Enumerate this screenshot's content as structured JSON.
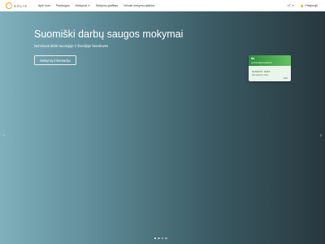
{
  "nav": {
    "logo_text": "SOLIS",
    "links": [
      "Apie mus",
      "Paslaugos",
      "Mokymai",
      "Mokymų grafikas",
      "Virtuali mokymų aplinka"
    ],
    "language": "LT",
    "login": "Prisijungti"
  },
  "hero": {
    "title": "Suomiški darbų saugos mokymai",
    "subtitle": "Nominuoti dirbti Suomijoje ir Švedijoje bendrovės",
    "button": "Mokymų informacija"
  },
  "card": {
    "brand": "tta",
    "subtitle": "työturvallisuuskortti",
    "number": "0160176 0297",
    "name": "Esimerkkinen Tiina",
    "year": "2023"
  },
  "carousel": {
    "slides": 4,
    "active": 0
  },
  "colors": {
    "accent": "#e8a317",
    "card_green": "#4cae57"
  }
}
